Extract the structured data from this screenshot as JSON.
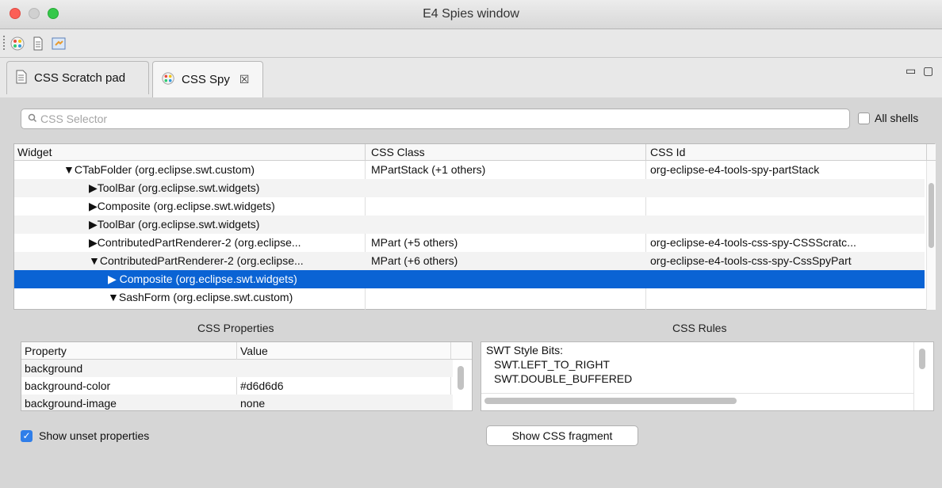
{
  "window": {
    "title": "E4 Spies window"
  },
  "toolbar": {
    "icons": [
      "css-spy-icon",
      "scratch-pad-icon",
      "bundle-spy-icon"
    ]
  },
  "tabs": [
    {
      "label": "CSS Scratch pad",
      "icon": "document-icon"
    },
    {
      "label": "CSS Spy",
      "icon": "css-spy-icon",
      "close": "☒"
    }
  ],
  "view_controls": {
    "minimize": "▭",
    "maximize": "▢"
  },
  "search": {
    "placeholder": "CSS Selector",
    "icon": "search-icon"
  },
  "all_shells": {
    "label": "All shells",
    "checked": false
  },
  "tree": {
    "columns": [
      "Widget",
      "CSS Class",
      "CSS Id"
    ],
    "rows": [
      {
        "widget": "▼CTabFolder (org.eclipse.swt.custom)",
        "class": "MPartStack (+1 others)",
        "id": "org-eclipse-e4-tools-spy-partStack"
      },
      {
        "widget": "▶ToolBar (org.eclipse.swt.widgets)",
        "class": "",
        "id": ""
      },
      {
        "widget": "▶Composite (org.eclipse.swt.widgets)",
        "class": "",
        "id": ""
      },
      {
        "widget": "▶ToolBar (org.eclipse.swt.widgets)",
        "class": "",
        "id": ""
      },
      {
        "widget": "▶ContributedPartRenderer-2 (org.eclipse...",
        "class": "MPart (+5 others)",
        "id": "org-eclipse-e4-tools-css-spy-CSSScratc..."
      },
      {
        "widget": "▼ContributedPartRenderer-2 (org.eclipse...",
        "class": "MPart (+6 others)",
        "id": "org-eclipse-e4-tools-css-spy-CssSpyPart"
      },
      {
        "widget": "▶ Composite (org.eclipse.swt.widgets)",
        "class": "",
        "id": ""
      },
      {
        "widget": "▼SashForm (org.eclipse.swt.custom)",
        "class": "",
        "id": ""
      }
    ]
  },
  "properties": {
    "title": "CSS Properties",
    "columns": [
      "Property",
      "Value"
    ],
    "rows": [
      {
        "property": "background",
        "value": ""
      },
      {
        "property": "background-color",
        "value": "#d6d6d6"
      },
      {
        "property": "background-image",
        "value": "none"
      }
    ]
  },
  "rules": {
    "title": "CSS Rules",
    "lines": [
      "SWT Style Bits:",
      "SWT.LEFT_TO_RIGHT",
      "SWT.DOUBLE_BUFFERED"
    ]
  },
  "show_unset": {
    "label": "Show unset properties",
    "checked": true
  },
  "show_fragment": {
    "label": "Show CSS fragment"
  },
  "colors": {
    "selection": "#0a63d4",
    "panel": "#d6d6d6",
    "checkbox_checked": "#2f7ee9"
  }
}
